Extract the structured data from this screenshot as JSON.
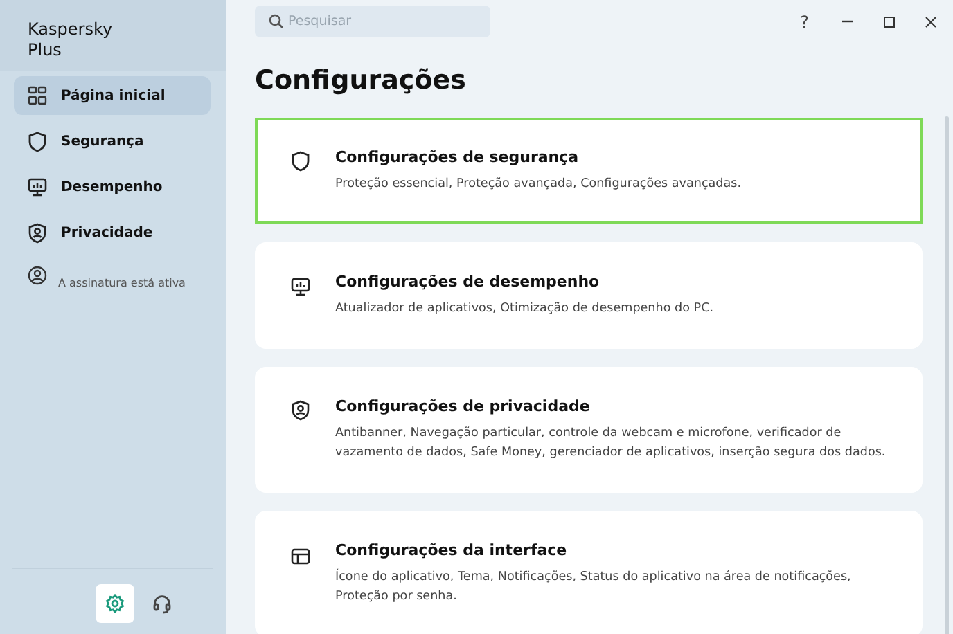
{
  "sidebar": {
    "app_name": "Kaspersky Plus",
    "items": [
      {
        "kind": "home",
        "label": "Página inicial",
        "selected": true
      },
      {
        "kind": "shield",
        "label": "Segurança",
        "selected": false
      },
      {
        "kind": "monitor",
        "label": "Desempenho",
        "selected": false
      },
      {
        "kind": "privacy",
        "label": "Privacidade",
        "selected": false
      }
    ],
    "subscription": {
      "text": "A assinatura está ativa"
    },
    "bottom_buttons": [
      {
        "kind": "settings",
        "selected": true
      },
      {
        "kind": "support",
        "selected": false
      }
    ]
  },
  "search": {
    "placeholder": "Pesquisar"
  },
  "window_controls": {
    "help": "?"
  },
  "page_title": "Configurações",
  "cards": [
    {
      "kind": "shield",
      "title": "Configurações de segurança",
      "description": "Proteção essencial, Proteção avançada, Configurações avançadas.",
      "focused": true
    },
    {
      "kind": "monitor",
      "title": "Configurações de desempenho",
      "description": "Atualizador de aplicativos, Otimização de desempenho do PC.",
      "focused": false
    },
    {
      "kind": "privacy",
      "title": "Configurações de privacidade",
      "description": "Antibanner, Navegação particular, controle da webcam e microfone, verificador de vazamento de dados, Safe Money, gerenciador de aplicativos, inserção segura dos dados.",
      "focused": false
    },
    {
      "kind": "interface",
      "title": "Configurações da interface",
      "description": "Ícone do aplicativo, Tema, Notificações, Status do aplicativo na área de notificações, Proteção por senha.",
      "focused": false
    }
  ]
}
